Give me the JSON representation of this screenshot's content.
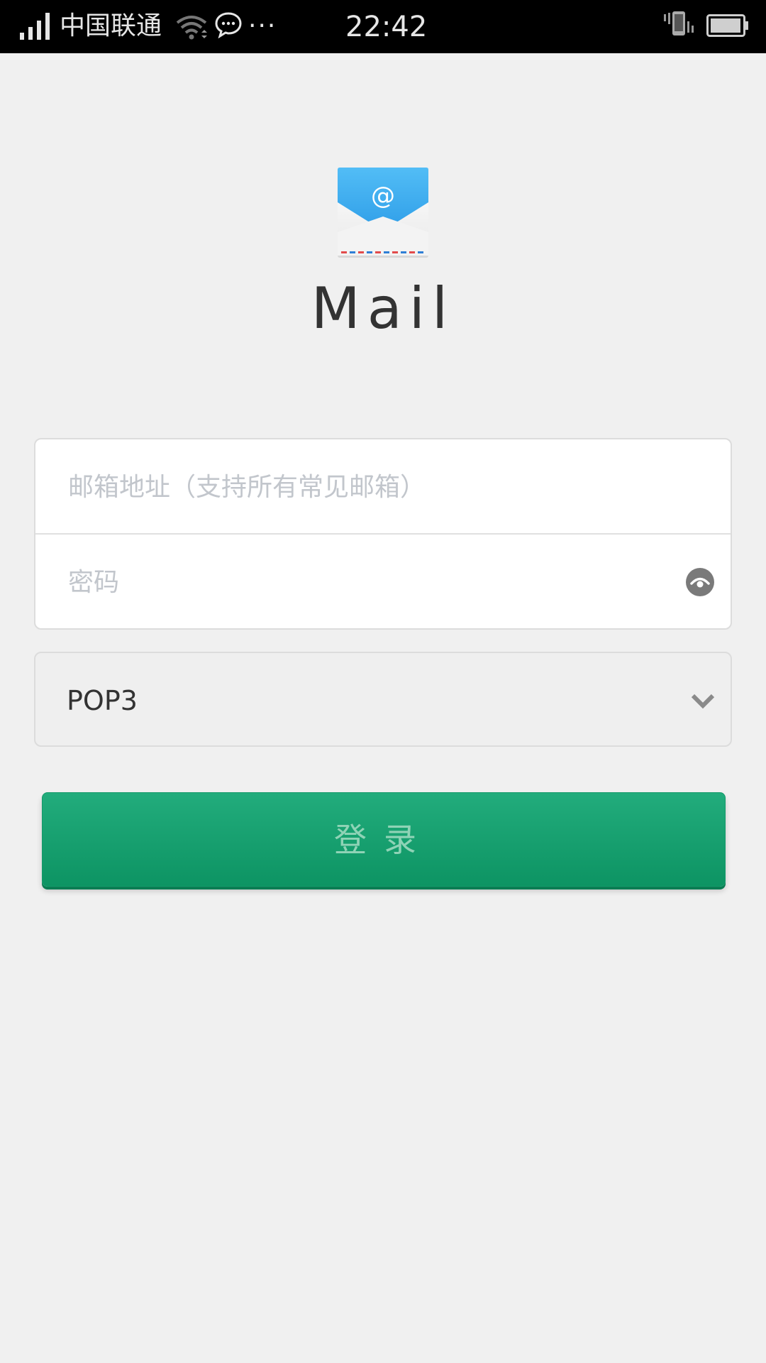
{
  "status_bar": {
    "carrier": "中国联通",
    "more": "···",
    "time": "22:42",
    "icons": [
      "signal-icon",
      "wifi-icon",
      "chat-icon",
      "vibrate-icon",
      "battery-icon"
    ]
  },
  "app": {
    "title": "Mail",
    "logo_icon": "mail-envelope-icon"
  },
  "form": {
    "email_placeholder": "邮箱地址（支持所有常见邮箱）",
    "email_value": "",
    "password_placeholder": "密码",
    "password_value": "",
    "password_toggle_icon": "eye-icon",
    "protocol": "POP3",
    "protocol_icon": "chevron-down-icon"
  },
  "login_button": {
    "label": "登录"
  },
  "colors": {
    "background": "#f0f0f0",
    "status_bar": "#000000",
    "button_green": "#14a06c",
    "button_text": "#8fd3b6",
    "placeholder": "#c2c6cc"
  }
}
